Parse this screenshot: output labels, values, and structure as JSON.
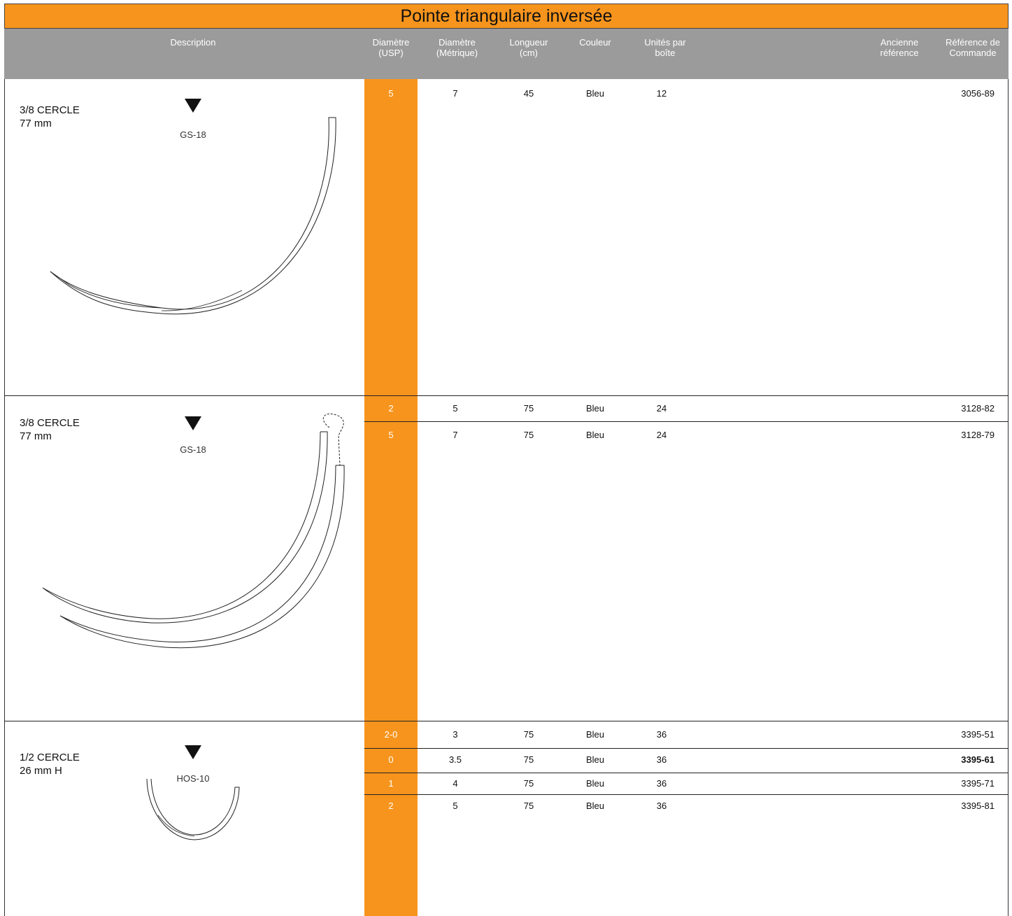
{
  "title": "Pointe triangulaire inversée",
  "headers": {
    "description": "Description",
    "usp": [
      "Diamètre",
      "(USP)"
    ],
    "metric": [
      "Diamètre",
      "(Métrique)"
    ],
    "length": [
      "Longueur",
      "(cm)"
    ],
    "color": "Couleur",
    "units": [
      "Unités par",
      "boîte"
    ],
    "old_ref": [
      "Ancienne",
      "référence"
    ],
    "order_ref": [
      "Référence de",
      "Commande"
    ]
  },
  "colors": {
    "accent": "#F7941D",
    "header_gray": "#9b9b9c"
  },
  "sections": [
    {
      "shape": "3/8 CERCLE",
      "size": "77 mm",
      "needle": "GS-18",
      "icon": "reverse-cutting-triangle-icon",
      "rows": [
        {
          "usp": "5",
          "metric": "7",
          "length": "45",
          "color": "Bleu",
          "units": "12",
          "old_ref": "",
          "ref": "3056-89",
          "bold": false
        }
      ]
    },
    {
      "shape": "3/8 CERCLE",
      "size": "77 mm",
      "needle": "GS-18",
      "icon": "reverse-cutting-triangle-icon",
      "rows": [
        {
          "usp": "2",
          "metric": "5",
          "length": "75",
          "color": "Bleu",
          "units": "24",
          "old_ref": "",
          "ref": "3128-82",
          "bold": false
        },
        {
          "usp": "5",
          "metric": "7",
          "length": "75",
          "color": "Bleu",
          "units": "24",
          "old_ref": "",
          "ref": "3128-79",
          "bold": false
        }
      ]
    },
    {
      "shape": "1/2 CERCLE",
      "size": "26 mm H",
      "needle": "HOS-10",
      "icon": "reverse-cutting-triangle-icon",
      "rows": [
        {
          "usp": "2-0",
          "metric": "3",
          "length": "75",
          "color": "Bleu",
          "units": "36",
          "old_ref": "",
          "ref": "3395-51",
          "bold": false
        },
        {
          "usp": "0",
          "metric": "3.5",
          "length": "75",
          "color": "Bleu",
          "units": "36",
          "old_ref": "",
          "ref": "3395-61",
          "bold": true
        },
        {
          "usp": "1",
          "metric": "4",
          "length": "75",
          "color": "Bleu",
          "units": "36",
          "old_ref": "",
          "ref": "3395-71",
          "bold": false
        },
        {
          "usp": "2",
          "metric": "5",
          "length": "75",
          "color": "Bleu",
          "units": "36",
          "old_ref": "",
          "ref": "3395-81",
          "bold": false
        }
      ]
    }
  ]
}
